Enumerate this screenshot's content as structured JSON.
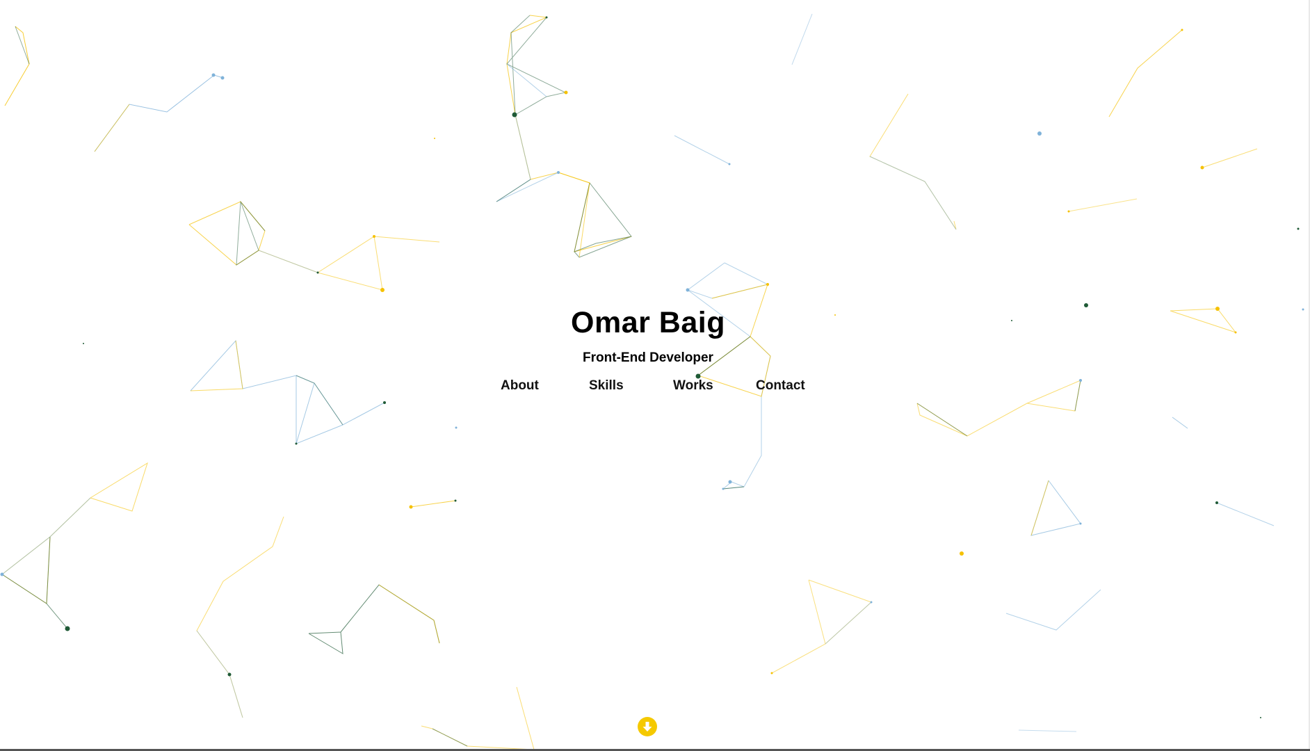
{
  "hero": {
    "name": "Omar Baig",
    "role": "Front-End Developer"
  },
  "nav": {
    "items": [
      "About",
      "Skills",
      "Works",
      "Contact"
    ]
  },
  "scroll_button": {
    "icon": "arrow-down-icon",
    "color": "#f5c900"
  },
  "theme": {
    "background": "#ffffff",
    "particle_colors": [
      "#f5c100",
      "#7fb2d9",
      "#1f5a36"
    ]
  }
}
